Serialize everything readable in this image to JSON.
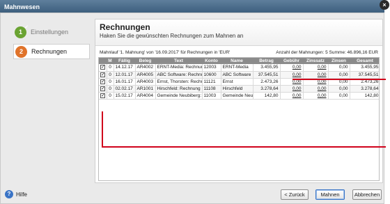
{
  "window": {
    "title": "Mahnwesen",
    "close_glyph": "×"
  },
  "sidebar": {
    "steps": [
      {
        "num": "1",
        "label": "Einstellungen",
        "done": true
      },
      {
        "num": "2",
        "label": "Rechnungen",
        "active": true
      }
    ]
  },
  "main": {
    "title": "Rechnungen",
    "subtitle": "Haken Sie die gewünschten Rechnungen zum Mahnen an",
    "info_left": "Mahnlauf '1. Mahnung' von '16.09.2017' für Rechnungen in 'EUR'",
    "info_right": "Anzahl der Mahnungen: 5 Summe: 46.896,16 EUR"
  },
  "table": {
    "headers": [
      "",
      "M",
      "Fällig",
      "Beleg",
      "Text",
      "Konto",
      "Name",
      "Betrag",
      "Gebühr",
      "Zinssatz",
      "Zinsen",
      "Gesamt"
    ],
    "rows": [
      {
        "checked": "✓",
        "m": "0",
        "faellig": "14.12.17",
        "beleg": "AR4002",
        "text": "ERNT-Media: Rechnung N",
        "konto": "12003",
        "name": "ERNT-Media",
        "betrag": "3.455,95",
        "gebuehr": "0,00",
        "zinssatz": "0,00",
        "zinsen": "0,00",
        "gesamt": "3.455,95"
      },
      {
        "checked": "✓",
        "m": "0",
        "faellig": "12.01.17",
        "beleg": "AR4005",
        "text": "ABC Software: Rechnung",
        "konto": "10600",
        "name": "ABC Software",
        "betrag": "37.545,51",
        "gebuehr": "0,00",
        "zinssatz": "0,00",
        "zinsen": "0,00",
        "gesamt": "37.545,51"
      },
      {
        "checked": "✓",
        "m": "0",
        "faellig": "16.01.17",
        "beleg": "AR4003",
        "text": "Ernst, Thorsten: Rechnur",
        "konto": "11121",
        "name": "Ernst",
        "betrag": "2.473,26",
        "gebuehr": "0,00",
        "zinssatz": "0,00",
        "zinsen": "0,00",
        "gesamt": "2.473,26"
      },
      {
        "checked": "✓",
        "m": "0",
        "faellig": "02.02.17",
        "beleg": "AR1001",
        "text": "Hirschfeld: Rechnung Nr.",
        "konto": "11108",
        "name": "Hirschfeld",
        "betrag": "3.278,64",
        "gebuehr": "0,00",
        "zinssatz": "0,00",
        "zinsen": "0,00",
        "gesamt": "3.278,64"
      },
      {
        "checked": "✓",
        "m": "0",
        "faellig": "15.02.17",
        "beleg": "AR4004",
        "text": "Gemeinde Neubiberg: Rec",
        "konto": "11003",
        "name": "Gemeinde Neubib",
        "betrag": "142,80",
        "gebuehr": "0,00",
        "zinssatz": "0,00",
        "zinsen": "0,00",
        "gesamt": "142,80"
      }
    ]
  },
  "footer": {
    "help_glyph": "?",
    "help_label": "Hilfe",
    "back_button": "< Zurück",
    "primary_button": "Mahnen",
    "cancel_button": "Abbrechen"
  },
  "colors": {
    "annotation": "#d0021b",
    "step_done": "#6aa332",
    "step_active": "#e0732a",
    "accent": "#3a74c6"
  },
  "icons": {
    "close": "close-icon",
    "help": "help-icon",
    "step_done": "checkmark-icon"
  }
}
